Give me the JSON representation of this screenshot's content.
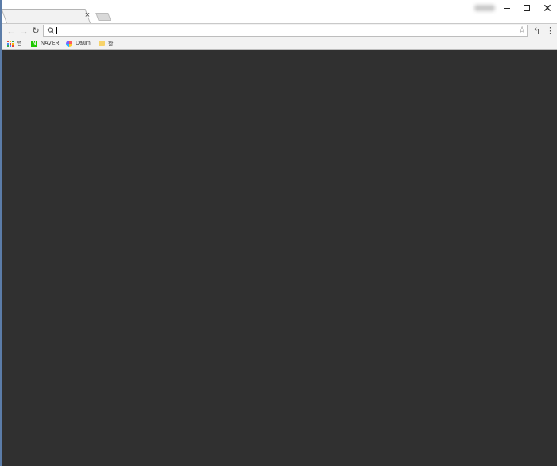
{
  "tabs": [
    {
      "title": "",
      "close_glyph": "×"
    }
  ],
  "window_controls": {
    "minimize_glyph": "–",
    "close_glyph": "✕"
  },
  "toolbar": {
    "back_glyph": "←",
    "forward_glyph": "→",
    "reload_glyph": "↻",
    "omnibox": {
      "value": "",
      "placeholder": ""
    },
    "star_glyph": "☆",
    "extension_glyph": "↰",
    "menu_glyph": "⋮"
  },
  "bookmarks": {
    "items": [
      {
        "label": "앱",
        "icon": "apps-grid-icon"
      },
      {
        "label": "NAVER",
        "icon": "naver-logo-icon"
      },
      {
        "label": "Daum",
        "icon": "daum-logo-icon"
      },
      {
        "label": "한",
        "icon": "folder-icon"
      }
    ]
  },
  "colors": {
    "content_background": "#303030",
    "toolbar_background": "#f2f2f2",
    "window_border": "#5b7ca8"
  }
}
